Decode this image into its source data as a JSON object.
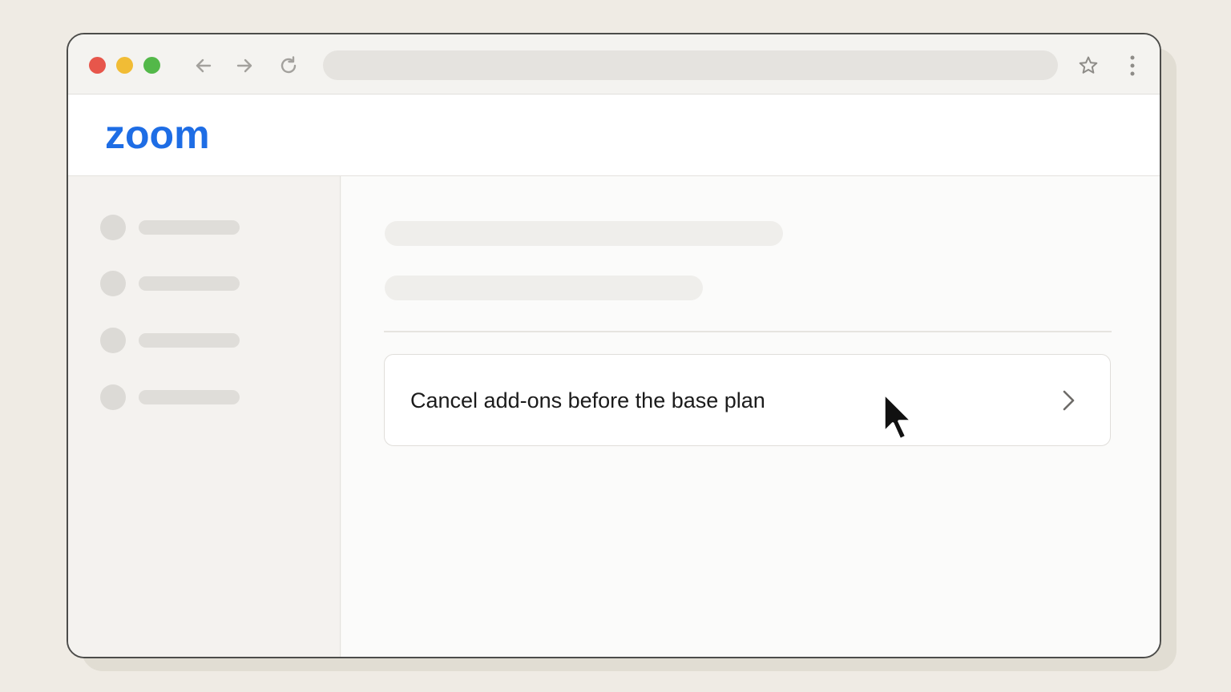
{
  "browser": {
    "address_value": "",
    "icons": [
      "back-arrow-icon",
      "forward-arrow-icon",
      "reload-icon",
      "star-icon",
      "more-vertical-icon"
    ],
    "traffic_colors": {
      "close": "#e7564b",
      "minimize": "#f1bc35",
      "maximize": "#53b849"
    }
  },
  "header": {
    "logo_text": "zoom",
    "brand_color": "#1e6de5"
  },
  "main": {
    "option_card": {
      "label": "Cancel add-ons before the base plan",
      "icon": "chevron-right-icon"
    }
  }
}
